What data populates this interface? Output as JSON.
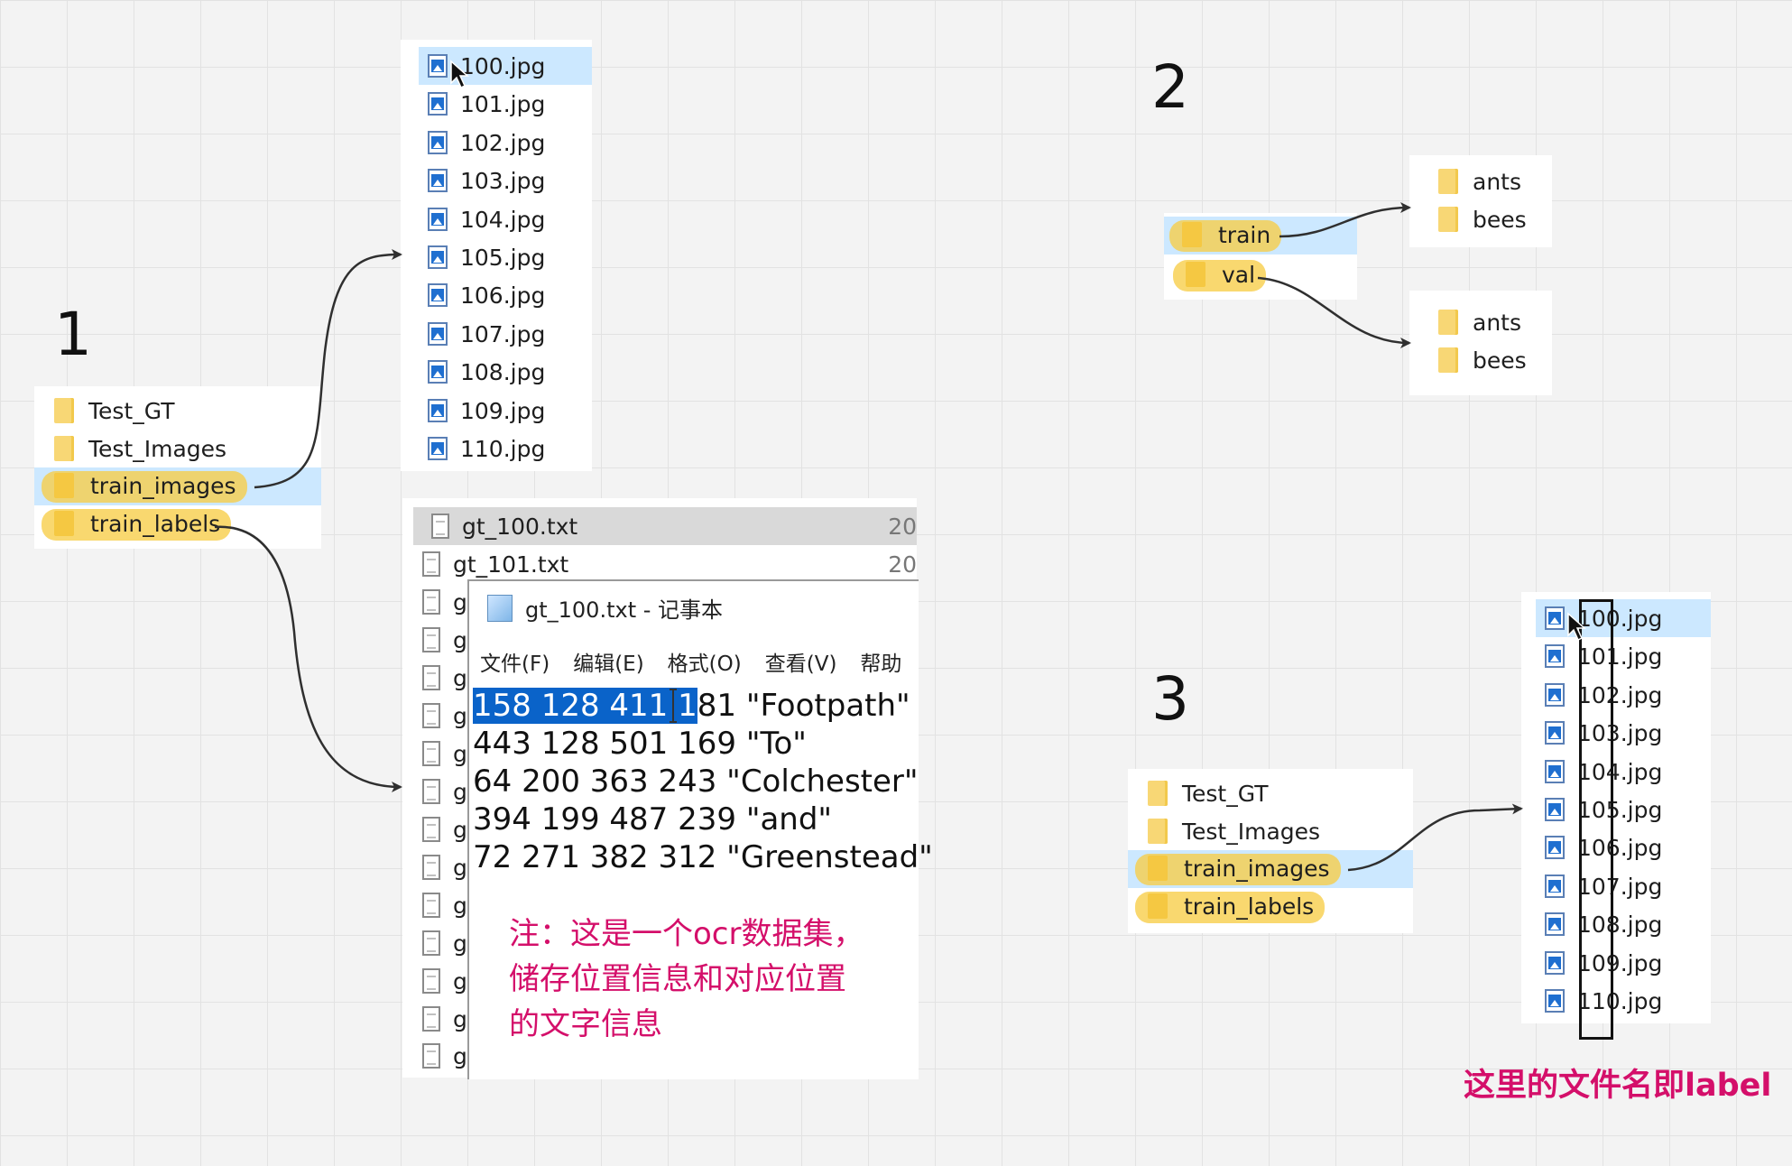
{
  "sections": [
    "1",
    "2",
    "3"
  ],
  "section1": {
    "folders": [
      "Test_GT",
      "Test_Images",
      "train_images",
      "train_labels"
    ],
    "images": [
      "100.jpg",
      "101.jpg",
      "102.jpg",
      "103.jpg",
      "104.jpg",
      "105.jpg",
      "106.jpg",
      "107.jpg",
      "108.jpg",
      "109.jpg",
      "110.jpg"
    ],
    "gt_files": [
      {
        "name": "gt_100.txt",
        "size": "20"
      },
      {
        "name": "gt_101.txt",
        "size": "20"
      }
    ],
    "gt_partial_rows": [
      "g",
      "g",
      "g",
      "g",
      "g",
      "g",
      "g",
      "g",
      "g",
      "g",
      "g",
      "g",
      "g"
    ],
    "notepad": {
      "title": "gt_100.txt - 记事本",
      "menu": [
        "文件(F)",
        "编辑(E)",
        "格式(O)",
        "查看(V)",
        "帮助"
      ],
      "line1_selected": "158 128 411 1",
      "line1_rest": "81 \"Footpath\"",
      "lines": [
        "443 128 501 169 \"To\"",
        "64 200 363 243 \"Colchester\"",
        "394 199 487 239 \"and\"",
        "72 271 382 312 \"Greenstead\""
      ]
    },
    "note_lines": [
      "注：这是一个ocr数据集，",
      "储存位置信息和对应位置",
      "的文字信息"
    ]
  },
  "section2": {
    "root_folders": [
      "train",
      "val"
    ],
    "train_children": [
      "ants",
      "bees"
    ],
    "val_children": [
      "ants",
      "bees"
    ]
  },
  "section3": {
    "folders": [
      "Test_GT",
      "Test_Images",
      "train_images",
      "train_labels"
    ],
    "images": [
      "100.jpg",
      "101.jpg",
      "102.jpg",
      "103.jpg",
      "104.jpg",
      "105.jpg",
      "106.jpg",
      "107.jpg",
      "108.jpg",
      "109.jpg",
      "110.jpg"
    ],
    "label_note": "这里的文件名即label"
  },
  "colors": {
    "highlight": "#f7cd46",
    "selection": "#cce8ff",
    "note": "#d40f6a",
    "text_selection": "#0a63c9"
  }
}
